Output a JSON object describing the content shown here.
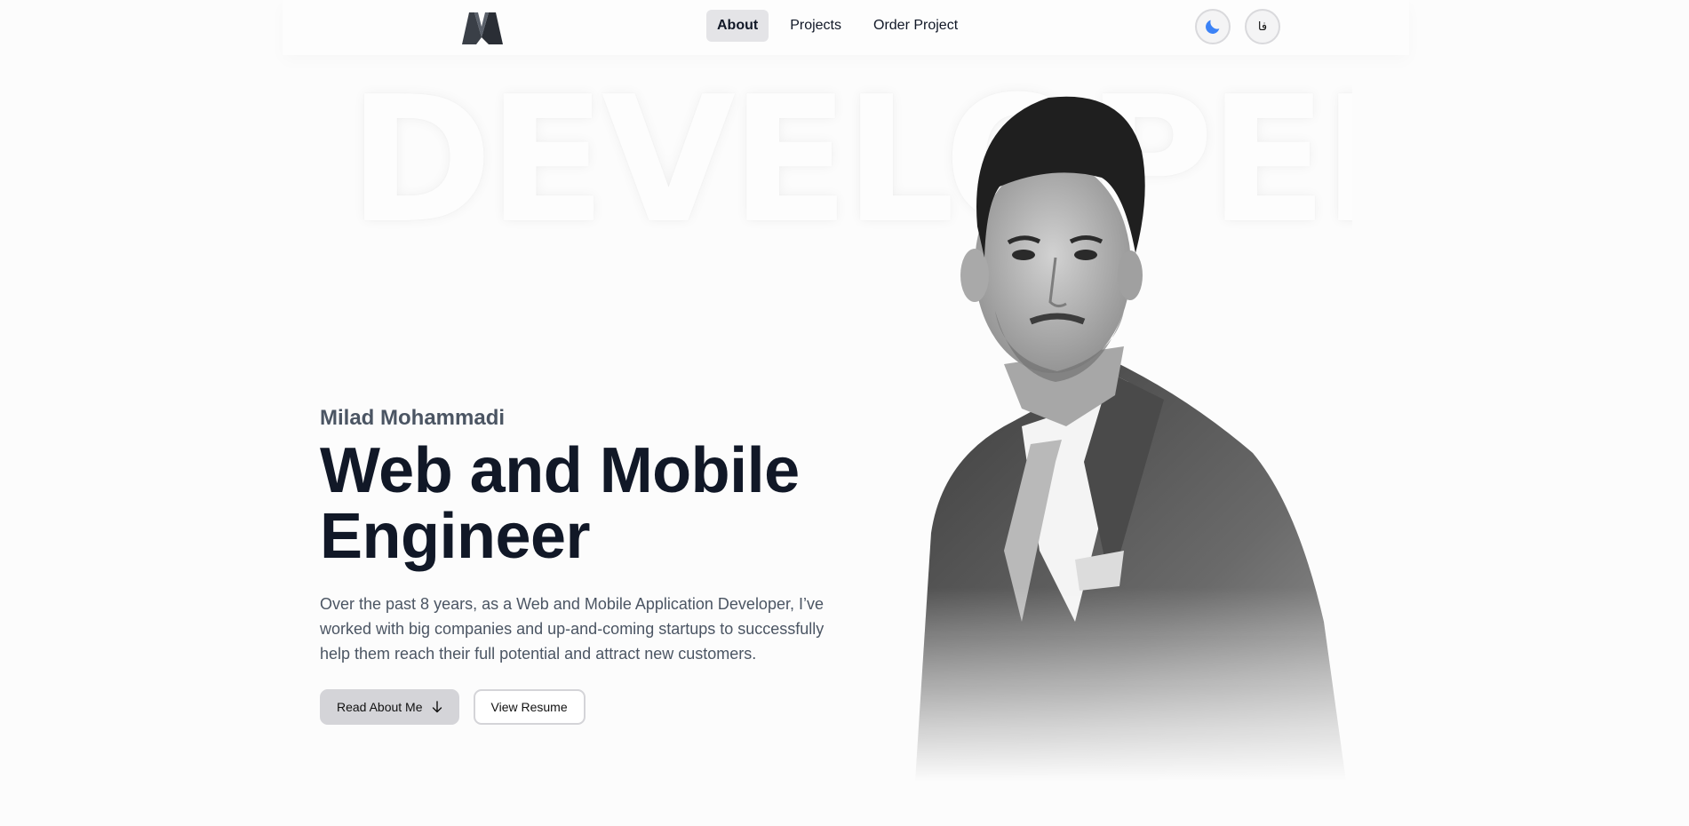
{
  "header": {
    "logo_icon": "mm-monogram-icon",
    "nav": [
      {
        "label": "About",
        "active": true
      },
      {
        "label": "Projects",
        "active": false
      },
      {
        "label": "Order Project",
        "active": false
      }
    ],
    "theme_icon": "moon-icon",
    "language_label": "فا"
  },
  "background_word": "DEVELOPER",
  "hero": {
    "name": "Milad Mohammadi",
    "title_line1": "Web and Mobile",
    "title_line2": "Engineer",
    "description": "Over the past 8 years, as a Web and Mobile Application Developer, I’ve worked with big companies and up-and-coming startups to successfully help them reach their full potential and attract new customers.",
    "primary_button": "Read About Me",
    "primary_button_icon": "arrow-down-icon",
    "secondary_button": "View Resume"
  },
  "colors": {
    "accent": "#3b82f6",
    "text_primary": "#111827",
    "text_secondary": "#4b5563",
    "active_nav_bg": "#e4e4e7"
  }
}
